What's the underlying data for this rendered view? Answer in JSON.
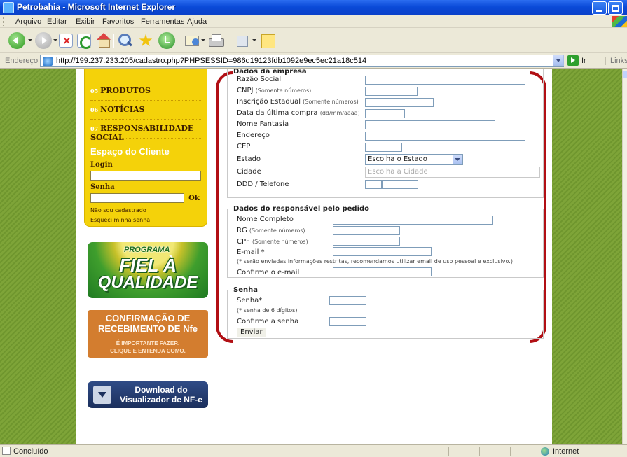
{
  "window": {
    "title": "Petrobahia - Microsoft Internet Explorer"
  },
  "menubar": {
    "items": [
      "Arquivo",
      "Editar",
      "Exibir",
      "Favoritos",
      "Ferramentas",
      "Ajuda"
    ]
  },
  "address": {
    "label": "Endereço",
    "url": "http://199.237.233.205/cadastro.php?PHPSESSID=986d19123fdb1092e9ec5ec21a18c514",
    "go_label": "Ir",
    "links_label": "Links"
  },
  "sidebar": {
    "menu": [
      {
        "num": "05",
        "label": "PRODUTOS"
      },
      {
        "num": "06",
        "label": "NOTÍCIAS"
      },
      {
        "num": "07",
        "label": "RESPONSABILIDADE SOCIAL"
      }
    ],
    "client_area_title": "Espaço do Cliente",
    "login_label": "Login",
    "password_label": "Senha",
    "ok_label": "Ok",
    "not_registered": "Não sou cadastrado",
    "forgot_password": "Esqueci minha senha"
  },
  "banners": {
    "fiel": {
      "program": "PROGRAMA",
      "line1": "FIEL À",
      "line2": "QUALIDADE"
    },
    "nfe": {
      "line1": "CONFIRMAÇÃO DE",
      "line2": "RECEBIMENTO DE Nfe",
      "line3": "É IMPORTANTE FAZER.",
      "line4": "CLIQUE E ENTENDA COMO."
    },
    "download": {
      "line1": "Download do",
      "line2": "Visualizador de NF-e"
    }
  },
  "form": {
    "empresa": {
      "legend": "Dados da empresa",
      "razao_social": "Razão Social",
      "cnpj": "CNPJ",
      "cnpj_hint": "(Somente números)",
      "inscricao": "Inscrição Estadual",
      "inscricao_hint": "(Somente números)",
      "data_compra": "Data da última compra",
      "data_hint": "(dd/mm/aaaa)",
      "nome_fantasia": "Nome Fantasia",
      "endereco": "Endereço",
      "cep": "CEP",
      "estado": "Estado",
      "estado_value": "Escolha o Estado",
      "cidade": "Cidade",
      "cidade_value": "Escolha a Cidade",
      "telefone": "DDD / Telefone"
    },
    "responsavel": {
      "legend": "Dados do responsável pelo pedido",
      "nome": "Nome Completo",
      "rg": "RG",
      "rg_hint": "(Somente números)",
      "cpf": "CPF",
      "cpf_hint": "(Somente números)",
      "email": "E-mail *",
      "email_note": "(* serão enviadas informações restritas, recomendamos utilizar email de uso pessoal e exclusivo.)",
      "confirm_email": "Confirme o e-mail"
    },
    "senha": {
      "legend": "Senha",
      "senha": "Senha*",
      "senha_hint": "(* senha de 6 dígitos)",
      "confirm": "Confirme a senha"
    },
    "submit": "Enviar"
  },
  "status": {
    "text": "Concluído",
    "zone": "Internet"
  }
}
